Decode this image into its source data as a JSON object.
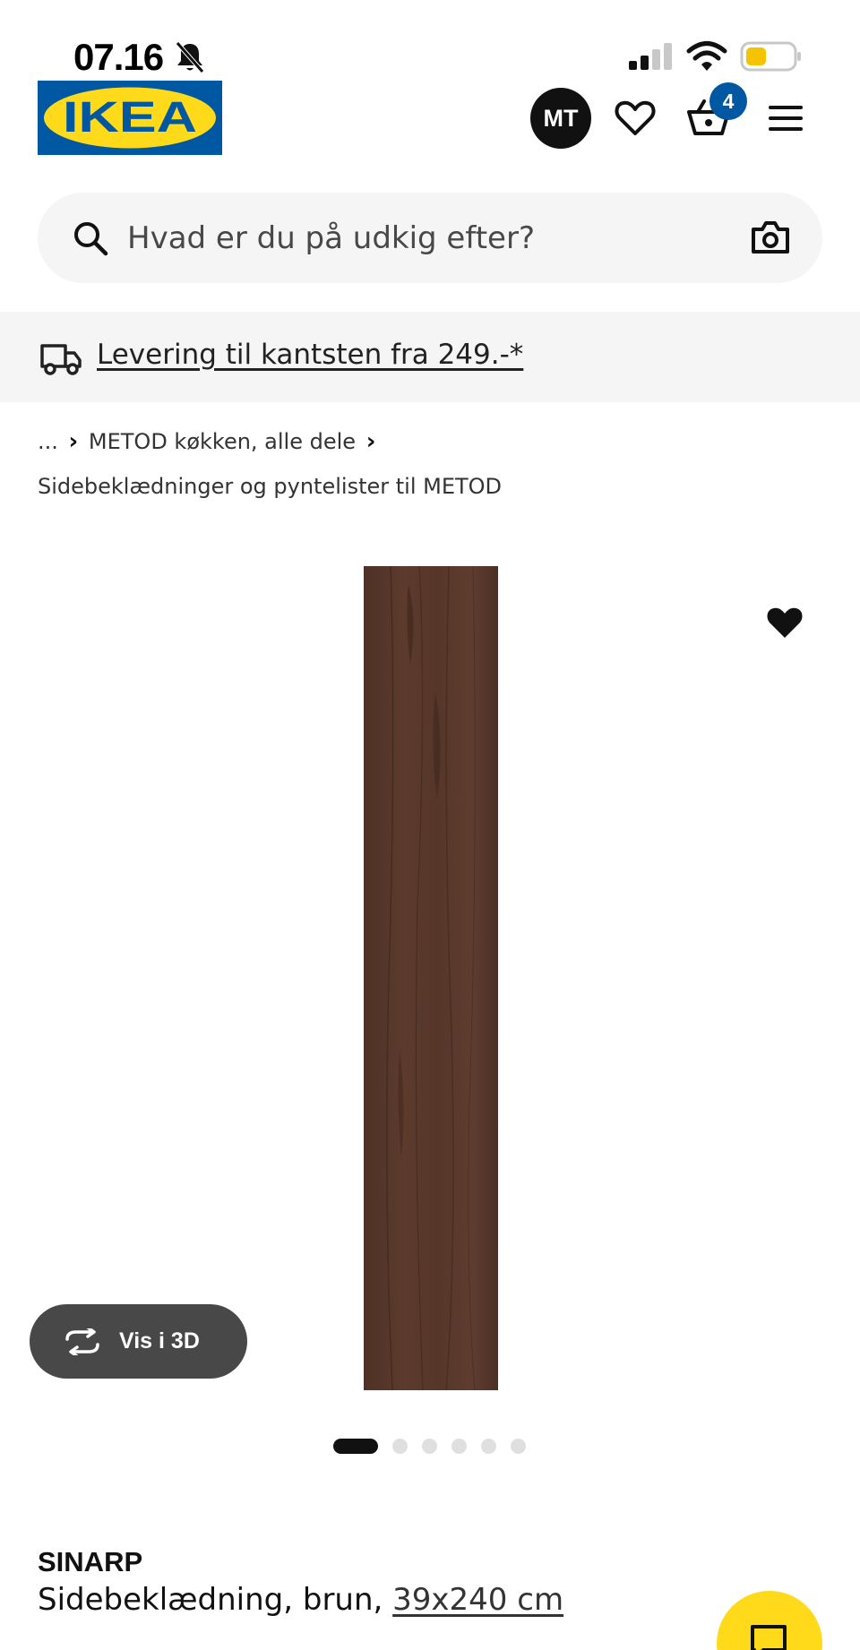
{
  "status_bar": {
    "time": "07.16",
    "icons": [
      "bell-muted-icon",
      "signal-icon",
      "wifi-icon",
      "battery-icon"
    ],
    "battery_color": "#f5c400"
  },
  "header": {
    "logo_text": "IKEA",
    "avatar_initials": "MT",
    "cart_count": "4",
    "brand_blue": "#0058a3",
    "brand_yellow": "#ffda1a"
  },
  "search": {
    "placeholder": "Hvad er du på udkig efter?"
  },
  "delivery_banner": {
    "text": "Levering til kantsten fra 249.-*"
  },
  "breadcrumb": {
    "ellipsis": "...",
    "items": [
      "METOD køkken, alle dele",
      "Sidebeklædninger og pyntelister til METOD"
    ]
  },
  "gallery": {
    "view_3d_label": "Vis i 3D",
    "image_count": 6,
    "active_index": 0
  },
  "product": {
    "name": "SINARP",
    "description": "Sidebeklædning, brun,",
    "size": "39x240 cm",
    "panel_color": "#5a3a2c"
  }
}
